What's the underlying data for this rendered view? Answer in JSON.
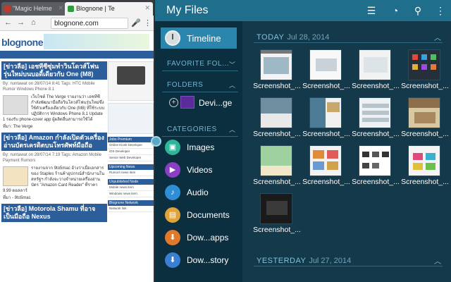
{
  "browser": {
    "tabs": [
      {
        "title": "\"Magic Helme",
        "favicon_color": "#c0392b"
      },
      {
        "title": "Blognone | Te",
        "favicon_color": "#2e9c3a"
      }
    ],
    "url": "blognone.com",
    "site_logo": "blognone",
    "articles": [
      {
        "title": "[ข่าวลือ] เอชทีซีซุ่มทำวินโดวส์โฟนรุ่นใหม่บนบอดี้เดียวกับ One (M8)",
        "meta": "By: nuntawat on 28/07/14 8:41 Tags: HTC Mobile Rumor Windows Phone 8.1",
        "body": "เว็บไซต์ The Verge รายงานว่า เอชทีซีกำลังพัฒนามือถือวินโดวส์โฟนรุ่นใหม่ซึ่งใช้ตัวเครื่องเดียวกับ One (M8) ที่ใช้ระบบปฏิบัติการ Windows Phone 8.1 Update 1 รองรับ phone-cover app ผู้ผลิตอื่นสามารถใช้ได้",
        "source": "ที่มา: The Verge"
      },
      {
        "title": "[ข่าวลือ] Amazon กำลังเปิดตัวเครื่องอ่านบัตรเครดิตบนโทรศัพท์มือถือ",
        "meta": "By: nuntawat on 28/07/14 7:19 Tags: Amazon Mobile Payment Rumors",
        "body": "รายงานจาก 9to5mac อ้างว่าเมื่อเอกสารของ Staples ร้านค้าอุปกรณ์สำนักงานในสหรัฐฯ กำลังจะวางจำหน่ายเครื่องอ่านบัตร \"Amazon Card Reader\" ที่ราคา 9.99 ดอลลาร์",
        "source": "ที่มา - 9to5mac"
      },
      {
        "title": "[ข่าวลือ] Motorola Shamu ที่อาจเป็นมือถือ Nexus"
      }
    ],
    "sidebar_heads": [
      "Jobs Premium",
      "Upcoming News",
      "Unpublished Node",
      "Blognone Network"
    ]
  },
  "files": {
    "app_title": "My Files",
    "actions": [
      "list-view-icon",
      "storage-usage-icon",
      "search-icon",
      "overflow-menu-icon"
    ],
    "nav_selected": "Timeline",
    "sections": {
      "favorites": "FAVORITE FOL...",
      "folders": "FOLDERS",
      "categories": "CATEGORIES"
    },
    "folder_item": "Devi...ge",
    "categories": [
      {
        "label": "Images",
        "color": "#2fb59a",
        "icon": "image-icon"
      },
      {
        "label": "Videos",
        "color": "#8a3fc3",
        "icon": "video-icon"
      },
      {
        "label": "Audio",
        "color": "#2f8fd6",
        "icon": "music-icon"
      },
      {
        "label": "Documents",
        "color": "#e0a33a",
        "icon": "document-icon"
      },
      {
        "label": "Dow...apps",
        "color": "#e07a2a",
        "icon": "download-icon"
      },
      {
        "label": "Dow...story",
        "color": "#3b7fd2",
        "icon": "history-icon"
      }
    ],
    "days": [
      {
        "label": "TODAY",
        "date": "Jul 28, 2014"
      },
      {
        "label": "YESTERDAY",
        "date": "Jul 27, 2014"
      }
    ],
    "thumbnail_caption": "Screenshot_...",
    "thumbnails_count": 13
  }
}
